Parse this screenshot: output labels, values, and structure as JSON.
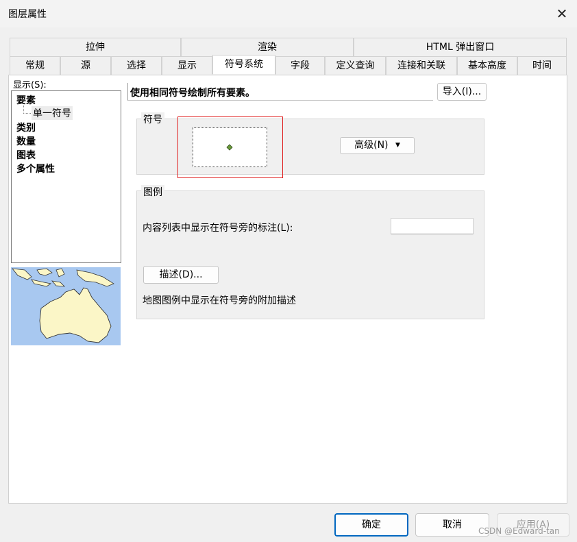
{
  "window": {
    "title": "图层属性"
  },
  "tabs_row1": [
    "拉伸",
    "渲染",
    "HTML 弹出窗口"
  ],
  "tabs_row2": [
    "常规",
    "源",
    "选择",
    "显示",
    "符号系统",
    "字段",
    "定义查询",
    "连接和关联",
    "基本高度",
    "时间"
  ],
  "active_tab": "符号系统",
  "show_panel": {
    "label": "显示(S):",
    "items": [
      "要素",
      "单一符号",
      "类别",
      "数量",
      "图表",
      "多个属性"
    ]
  },
  "symbology": {
    "description": "使用相同符号绘制所有要素。",
    "import_button": "导入(I)...",
    "symbol_group_title": "符号",
    "advanced_button": "高级(N)",
    "legend_group_title": "图例",
    "legend_label": "内容列表中显示在符号旁的标注(L):",
    "legend_input_value": "",
    "describe_button": "描述(D)...",
    "legend_desc_text": "地图图例中显示在符号旁的附加描述"
  },
  "footer": {
    "ok": "确定",
    "cancel": "取消",
    "apply": "应用(A)"
  },
  "watermark": "CSDN @Edward-tan",
  "colors": {
    "accent": "#0067c0",
    "highlight": "#e02020",
    "map_sea": "#a8c8f0",
    "map_land": "#fbf6c7",
    "symbol_point": "#6a9a3a"
  }
}
